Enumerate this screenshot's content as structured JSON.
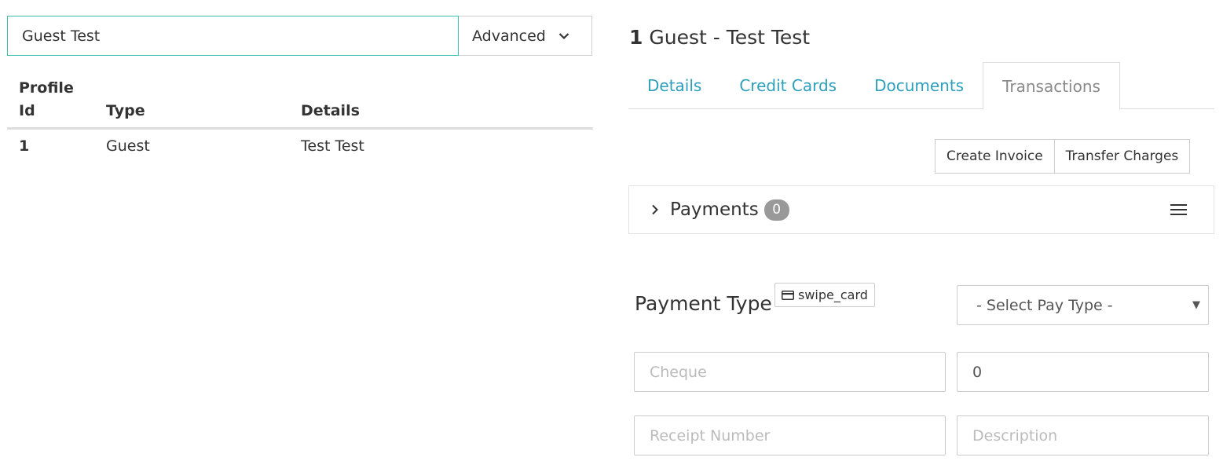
{
  "search": {
    "value": "Guest Test",
    "advanced_label": "Advanced"
  },
  "results": {
    "headers": {
      "profile_id_line1": "Profile",
      "profile_id_line2": "Id",
      "type": "Type",
      "details": "Details"
    },
    "rows": [
      {
        "id": "1",
        "type": "Guest",
        "details": "Test Test"
      }
    ]
  },
  "profile": {
    "number": "1",
    "title": "Guest - Test Test"
  },
  "tabs": [
    {
      "label": "Details"
    },
    {
      "label": "Credit Cards"
    },
    {
      "label": "Documents"
    },
    {
      "label": "Transactions",
      "active": true
    }
  ],
  "actions": {
    "create_invoice": "Create Invoice",
    "transfer_charges": "Transfer Charges"
  },
  "payments": {
    "label": "Payments",
    "count": "0"
  },
  "payment_form": {
    "payment_type_label": "Payment Type",
    "swipe_label": "swipe_card",
    "select_value": "- Select Pay Type -",
    "cheque_placeholder": "Cheque",
    "amount_value": "0",
    "receipt_placeholder": "Receipt Number",
    "description_placeholder": "Description"
  },
  "colors": {
    "accent": "#2e9fbd",
    "search_border": "#3bbfad",
    "badge": "#999999"
  },
  "icons": {
    "advanced": "chevron-down-icon",
    "payments_toggle": "chevron-right-icon",
    "payments_menu": "hamburger-menu-icon",
    "swipe": "credit-card-icon",
    "select": "caret-down-icon"
  }
}
